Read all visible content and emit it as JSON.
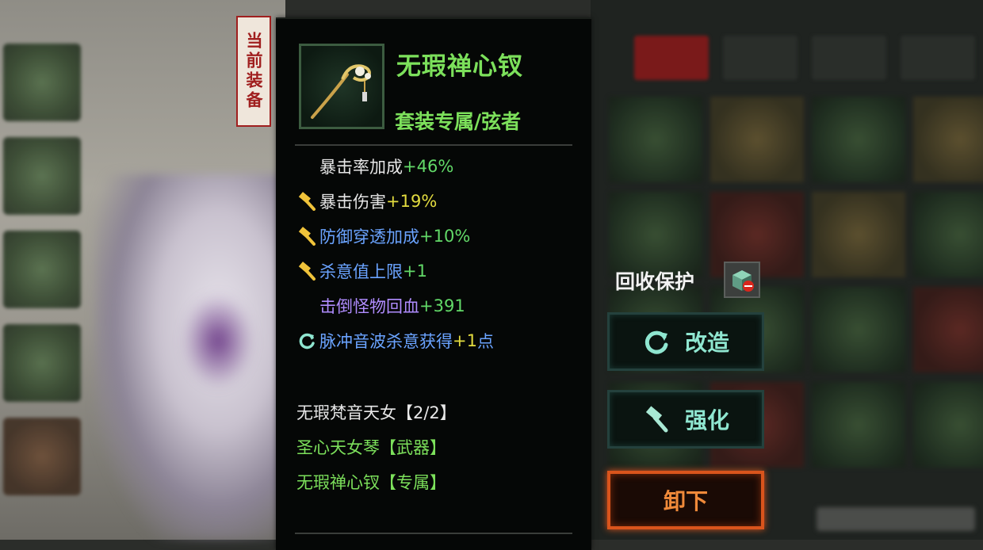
{
  "tag_label": "当前装备",
  "item": {
    "name": "无瑕禅心钗",
    "set_exclusive": "套装专属/弦者"
  },
  "stats": [
    {
      "name": "暴击率加成",
      "value": "+46%",
      "icon": "none",
      "name_color": "#e6e6e6",
      "value_color": "#62d968"
    },
    {
      "name": "暴击伤害",
      "value": "+19%",
      "icon": "hammer-icon",
      "name_color": "#e6e6e6",
      "value_color": "#e3dc3f"
    },
    {
      "name": "防御穿透加成",
      "value": "+10%",
      "icon": "hammer-icon",
      "name_color": "#6aa3ff",
      "value_color": "#62d968"
    },
    {
      "name": "杀意值上限",
      "value": "+1",
      "icon": "hammer-icon",
      "name_color": "#6aa3ff",
      "value_color": "#62d968"
    },
    {
      "name": "击倒怪物回血",
      "value": "+391",
      "icon": "none",
      "name_color": "#b08cff",
      "value_color": "#62d968"
    },
    {
      "name": "脉冲音波杀意获得",
      "value": "+1",
      "suffix": "点",
      "icon": "refresh-icon",
      "name_color": "#6aa3ff",
      "value_color": "#e3dc3f"
    }
  ],
  "set": {
    "title": "无瑕梵音天女【2/2】",
    "items": [
      "圣心天女琴【武器】",
      "无瑕禅心钗【专属】"
    ]
  },
  "recycle_protect_label": "回收保护",
  "buttons": {
    "remake": "改造",
    "enhance": "强化",
    "unequip": "卸下"
  },
  "colors": {
    "name_green": "#7ce05b",
    "tag_red": "#a01f1f",
    "button_text": "#8fe6d0",
    "unequip_orange": "#f08a3a"
  }
}
